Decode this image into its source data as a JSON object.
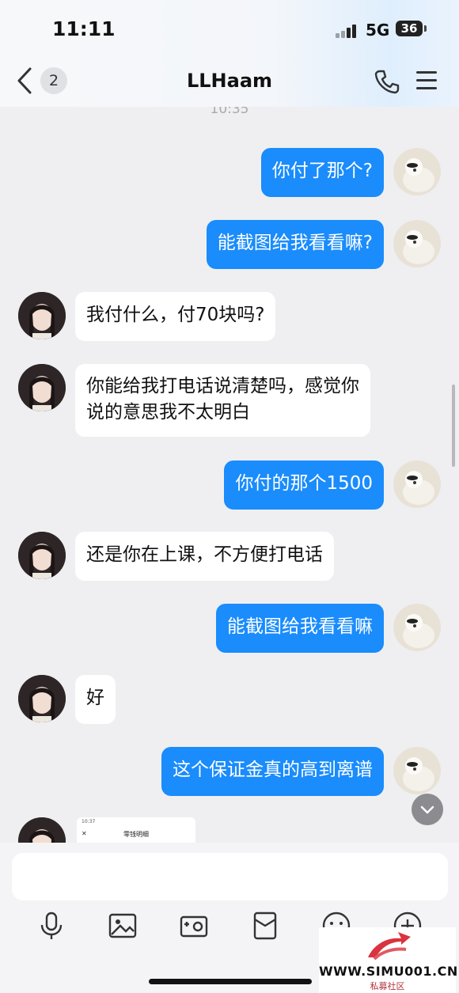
{
  "status_bar": {
    "time": "11:11",
    "network": "5G",
    "battery": "36"
  },
  "header": {
    "back_count": "2",
    "title": "LLHaam"
  },
  "chat": {
    "timestamp": "10:35",
    "messages": [
      {
        "from": "me",
        "text": "你付了那个?"
      },
      {
        "from": "me",
        "text": "能截图给我看看嘛?"
      },
      {
        "from": "other",
        "text": "我付什么，付70块吗?"
      },
      {
        "from": "other",
        "text_line1": "你能给我打电话说清楚吗，感觉你",
        "text_line2": "说的意思我不太明白"
      },
      {
        "from": "me",
        "text": "你付的那个1500"
      },
      {
        "from": "other",
        "text": "还是你在上课，不方便打电话"
      },
      {
        "from": "me",
        "text": "能截图给我看看嘛"
      },
      {
        "from": "other",
        "text": "好"
      },
      {
        "from": "me",
        "text": "这个保证金真的高到离谱"
      }
    ],
    "image_preview": {
      "time": "10:37",
      "title": "零钱明细"
    }
  },
  "toolbar": {
    "icons": [
      "microphone-icon",
      "image-icon",
      "camera-icon",
      "red-packet-icon",
      "emoji-icon",
      "plus-icon"
    ]
  },
  "watermark": {
    "text": "WWW.SIMU001.CN",
    "subtitle": "私募社区"
  },
  "colors": {
    "outgoing_bubble": "#1a8cfc",
    "incoming_bubble": "#ffffff",
    "background": "#efeff1"
  }
}
